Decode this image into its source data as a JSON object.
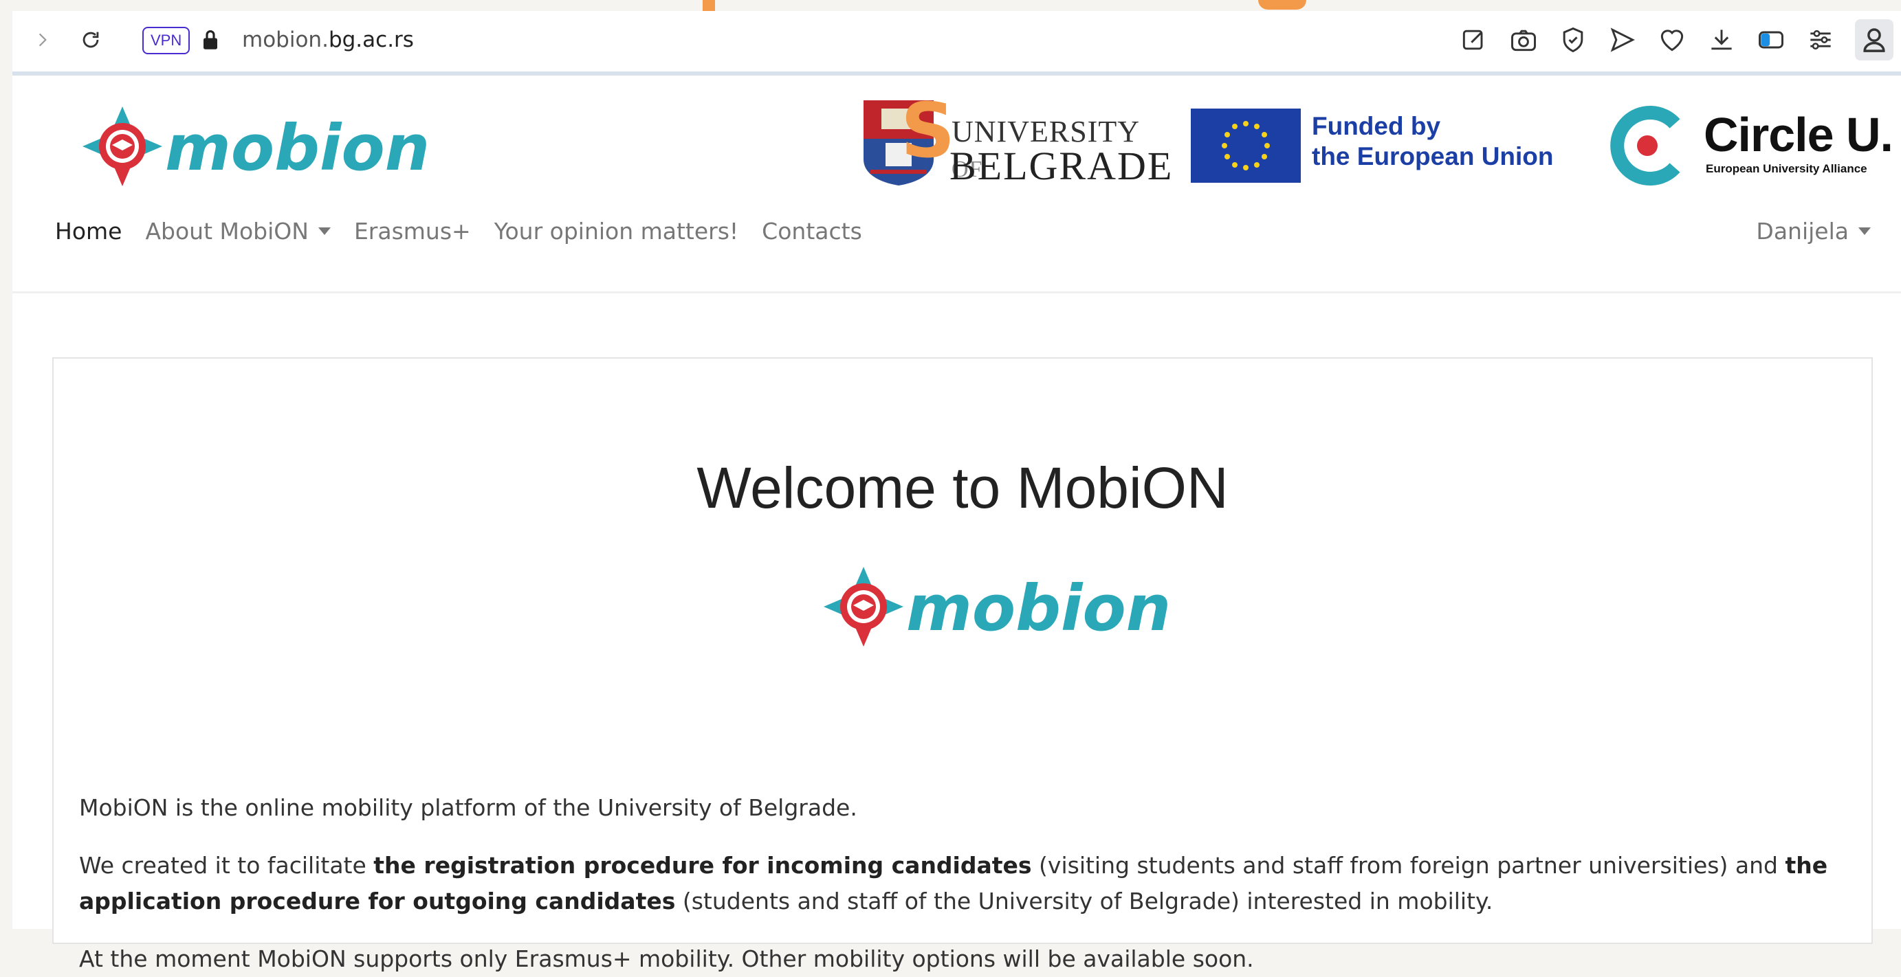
{
  "browser": {
    "vpn_label": "VPN",
    "url_domain_start": "mobion.",
    "url_domain_rest": "bg.ac.rs",
    "toolbar_icons": [
      "forward-icon",
      "reload-icon",
      "lock-icon",
      "edit-icon",
      "camera-icon",
      "shield-icon",
      "send-icon",
      "heart-icon",
      "download-icon",
      "sidebar-toggle-icon",
      "settings-icon",
      "profile-icon"
    ]
  },
  "header": {
    "logo_text": "mobion",
    "belgrade_line1": "UNIVERSITY",
    "belgrade_of": "OF",
    "belgrade_line2": "BELGRADE",
    "eu_text_line1": "Funded by",
    "eu_text_line2": "the European Union",
    "circle_title": "Circle U.",
    "circle_sub": "European University Alliance"
  },
  "nav": {
    "items": [
      {
        "label": "Home"
      },
      {
        "label": "About MobiON"
      },
      {
        "label": "Erasmus+"
      },
      {
        "label": "Your opinion matters!"
      },
      {
        "label": "Contacts"
      }
    ],
    "user": "Danijela"
  },
  "main": {
    "title": "Welcome to MobiON",
    "logo_text": "mobion",
    "p1": "MobiON is the online mobility platform of the University of Belgrade.",
    "p2_a": "We created it to facilitate ",
    "p2_b": "the registration procedure for incoming candidates",
    "p2_c": " (visiting students and staff from foreign partner universities) and ",
    "p2_d": "the application procedure for outgoing candidates",
    "p2_e": " (students and staff of the University of Belgrade) interested in mobility.",
    "p3": "At the moment MobiON supports only Erasmus+ mobility. Other mobility options will be available soon."
  },
  "colors": {
    "accent_teal": "#2aa8b7",
    "logo_red": "#d9303a",
    "eu_blue": "#1c3fa6",
    "vpn_purple": "#4a2bd0",
    "orange": "#f39a4a"
  }
}
